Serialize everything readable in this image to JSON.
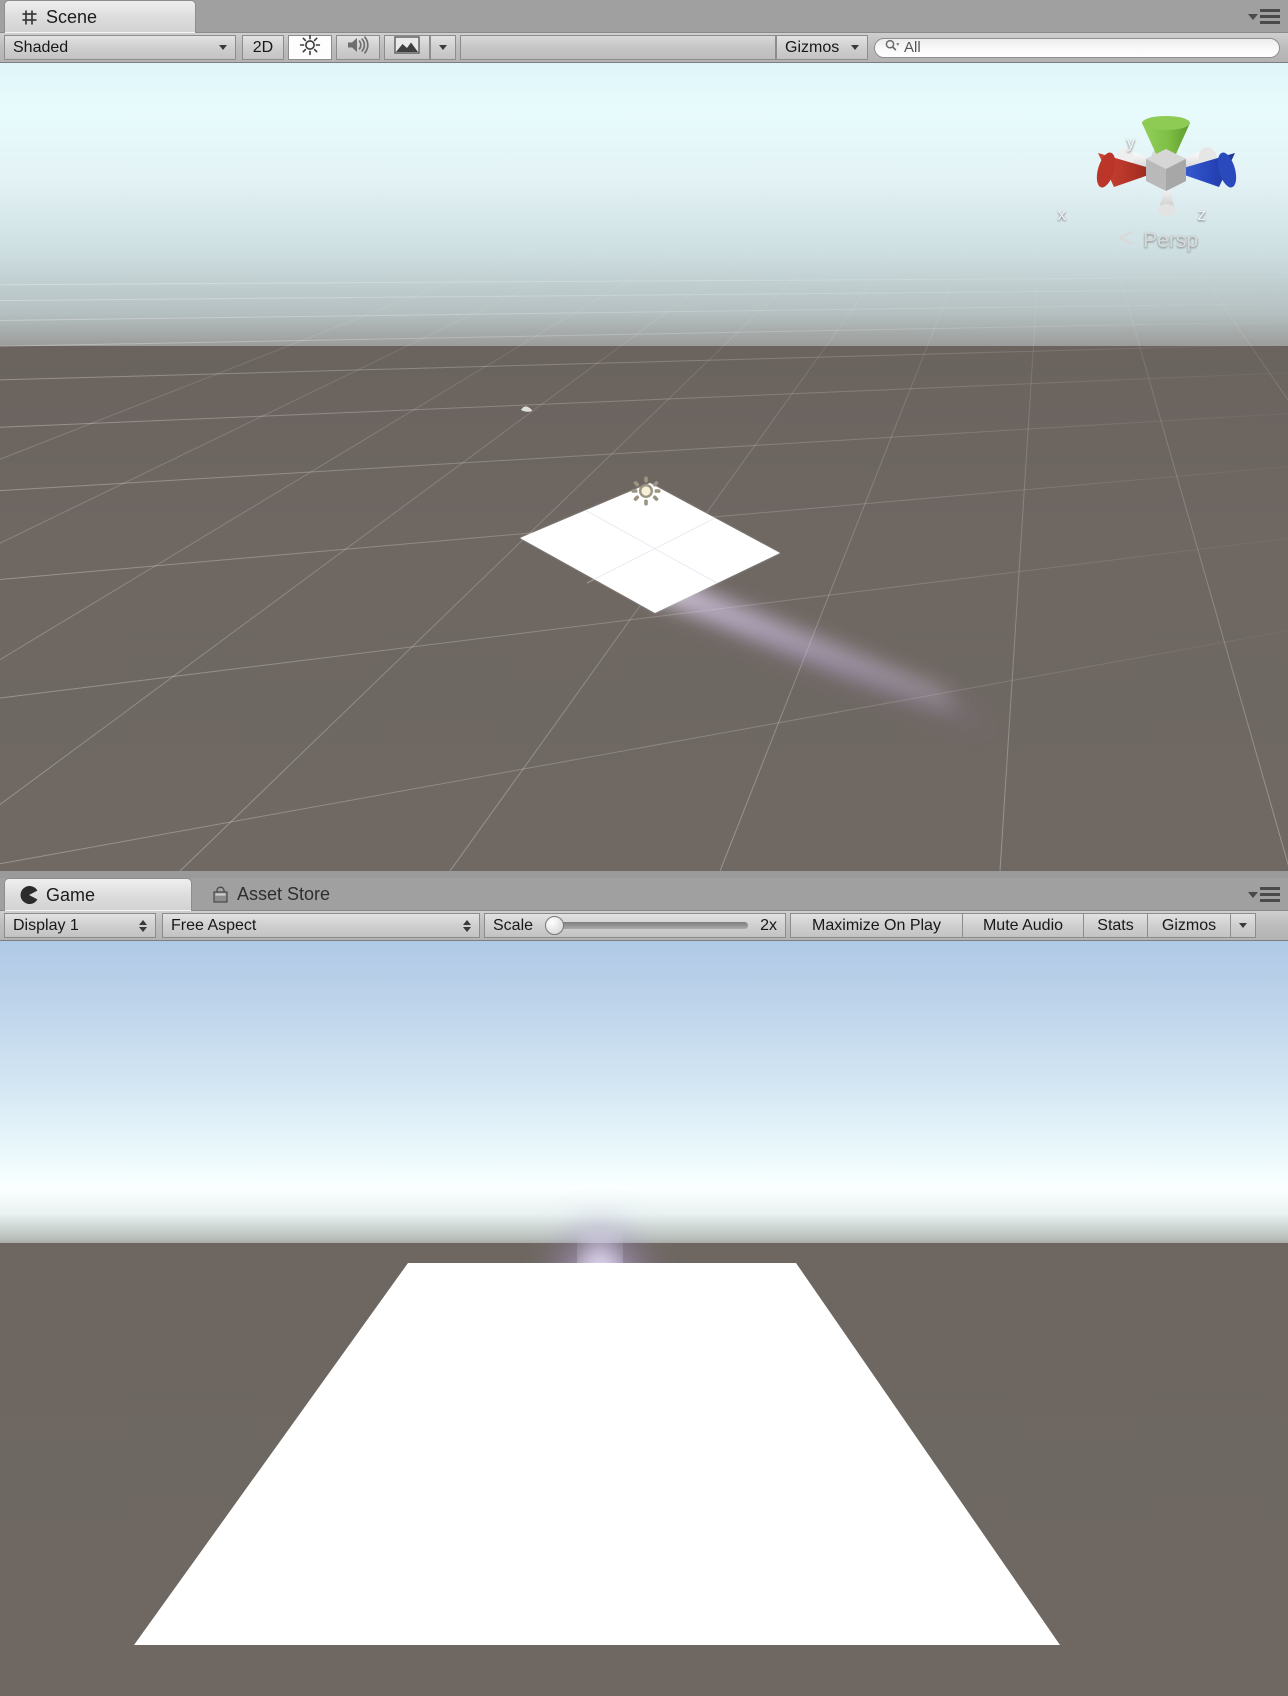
{
  "window": {
    "accent_blue": "#2b5fbd",
    "chrome_gray": "#9a9a9a"
  },
  "scene_panel": {
    "tab": {
      "label": "Scene",
      "icon": "grid-icon"
    },
    "menu_icon": "panel-options-icon",
    "toolbar": {
      "draw_mode": {
        "label": "Shaded",
        "icon": "chevron-down-icon"
      },
      "mode_2d": {
        "label": "2D"
      },
      "lighting_toggle": {
        "icon": "sun-icon",
        "state": "on"
      },
      "audio_toggle": {
        "icon": "speaker-icon",
        "state": "off"
      },
      "fx_toggle": {
        "icon": "image-fx-icon"
      },
      "fx_dropdown": {
        "icon": "chevron-down-icon"
      },
      "gizmos": {
        "label": "Gizmos",
        "icon": "chevron-down-icon"
      },
      "search": {
        "value": "All",
        "placeholder": "All",
        "icon": "search-icon"
      }
    },
    "gizmo": {
      "axis_x": "x",
      "axis_y": "y",
      "axis_z": "z",
      "projection": "Persp",
      "projection_icon": "chevron-left-icon",
      "lock_icon": "lock-open-icon",
      "color_x": "#b3342a",
      "color_y": "#7cbf3f",
      "color_z": "#2a50c8"
    },
    "scene_objects": {
      "quad_color": "#ffffff",
      "light_gizmo_icon": "point-light-icon",
      "particle_color": "#bda6e8",
      "ground_color": "#6e6762"
    }
  },
  "game_panel": {
    "tabs": [
      {
        "label": "Game",
        "icon": "game-icon",
        "active": true
      },
      {
        "label": "Asset Store",
        "icon": "store-icon",
        "active": false
      }
    ],
    "menu_icon": "panel-options-icon",
    "toolbar": {
      "display": {
        "label": "Display 1",
        "icon": "stepper-icon"
      },
      "aspect": {
        "label": "Free Aspect",
        "icon": "stepper-icon"
      },
      "scale": {
        "label": "Scale",
        "value": "2x",
        "slider_percent": 7
      },
      "maximize_on_play": {
        "label": "Maximize On Play"
      },
      "mute_audio": {
        "label": "Mute Audio"
      },
      "stats": {
        "label": "Stats"
      },
      "gizmos": {
        "label": "Gizmos",
        "icon": "chevron-down-icon"
      }
    },
    "render": {
      "sky_top_color": "#b0c9e6",
      "sky_horizon_color": "#fbffff",
      "ground_color": "#6e6762",
      "floor_color": "#ffffff",
      "plume_color": "#b9a4e6"
    }
  }
}
